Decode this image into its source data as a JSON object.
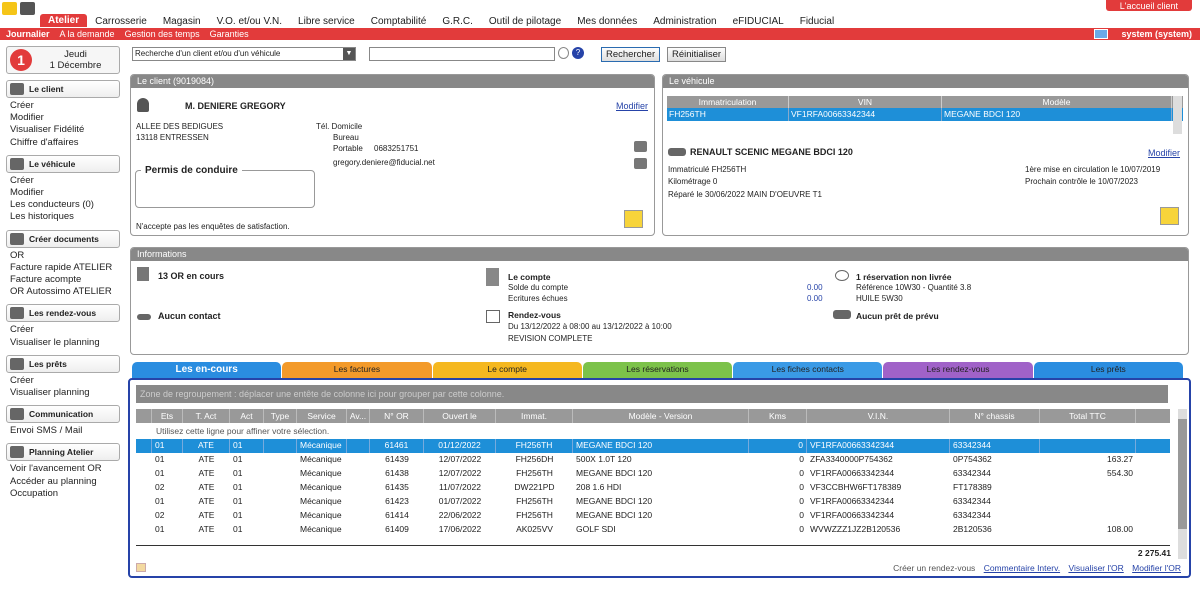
{
  "topnav": {
    "accueil": "L'accueil client",
    "menu": [
      "Atelier",
      "Carrosserie",
      "Magasin",
      "V.O. et/ou V.N.",
      "Libre service",
      "Comptabilité",
      "G.R.C.",
      "Outil de pilotage",
      "Mes données",
      "Administration",
      "eFIDUCIAL",
      "Fiducial"
    ]
  },
  "subnav": {
    "items": [
      "Journalier",
      "A la demande",
      "Gestion des temps",
      "Garanties"
    ],
    "user": "system (system)"
  },
  "sidebar": {
    "date_badge": "1",
    "date_day": "Jeudi",
    "date_full": "1 Décembre",
    "sections": [
      {
        "title": "Le client",
        "icon": "person-icon",
        "links": [
          "Créer",
          "Modifier",
          "Visualiser Fidélité",
          "Chiffre d'affaires"
        ]
      },
      {
        "title": "Le véhicule",
        "icon": "car-icon",
        "links": [
          "Créer",
          "Modifier",
          "Les conducteurs (0)",
          "Les historiques"
        ]
      },
      {
        "title": "Créer documents",
        "icon": "document-icon",
        "links": [
          "OR",
          "Facture rapide ATELIER",
          "Facture acompte",
          "OR Autossimo ATELIER"
        ]
      },
      {
        "title": "Les rendez-vous",
        "icon": "calendar-icon",
        "links": [
          "Créer",
          "Visualiser le planning"
        ]
      },
      {
        "title": "Les prêts",
        "icon": "person-icon",
        "links": [
          "Créer",
          "Visualiser planning"
        ]
      },
      {
        "title": "Communication",
        "icon": "phone-icon",
        "links": [
          "Envoi SMS / Mail"
        ]
      },
      {
        "title": "Planning Atelier",
        "icon": "calendar-icon",
        "links": [
          "Voir l'avancement OR",
          "Accéder au planning",
          "Occupation"
        ]
      }
    ]
  },
  "search": {
    "select_value": "Recherche d'un client et/ou d'un véhicule",
    "search_label": "Rechercher",
    "reset_label": "Réinitialiser"
  },
  "client": {
    "header": "Le client (9019084)",
    "name": "M. DENIERE GREGORY",
    "modify": "Modifier",
    "address1": "ALLEE DES BEDIGUES",
    "address2": "13118 ENTRESSEN",
    "tel_label": "Tél. Domicile",
    "bureau": "Bureau",
    "portable_label": "Portable",
    "portable": "0683251751",
    "email": "gregory.deniere@fiducial.net",
    "permis": "Permis de conduire",
    "enquete": "N'accepte pas les enquêtes de satisfaction."
  },
  "vehicle": {
    "header": "Le véhicule",
    "columns": [
      "Immatriculation",
      "VIN",
      "Modèle"
    ],
    "row": [
      "FH256TH",
      "VF1RFA00663342344",
      "MEGANE BDCI 120"
    ],
    "title": "RENAULT SCENIC MEGANE BDCI 120",
    "modify": "Modifier",
    "immat": "Immatriculé FH256TH",
    "km": "Kilométrage 0",
    "repare": "Réparé le 30/06/2022 MAIN D'OEUVRE T1",
    "mise_circ": "1ère mise en circulation le 10/07/2019",
    "controle": "Prochain contrôle le 10/07/2023"
  },
  "info": {
    "header": "Informations",
    "or_en_cours": "13 OR en cours",
    "contact": "Aucun contact",
    "compte_title": "Le compte",
    "solde_label": "Solde du compte",
    "solde": "0.00",
    "echues_label": "Ecritures échues",
    "echues": "0.00",
    "rdv_title": "Rendez-vous",
    "rdv_dates": "Du 13/12/2022 à 08:00 au 13/12/2022 à 10:00",
    "rdv_desc": "REVISION COMPLETE",
    "reservation": "1 réservation non livrée",
    "ref": "Référence 10W30 - Quantité 3.8",
    "huile": "HUILE 5W30",
    "pret": "Aucun prêt de prévu"
  },
  "tabs": [
    {
      "label": "Les en-cours",
      "color": "#2a8de0"
    },
    {
      "label": "Les factures",
      "color": "#f39a2a"
    },
    {
      "label": "Le compte",
      "color": "#f5b820"
    },
    {
      "label": "Les réservations",
      "color": "#7cc24a"
    },
    {
      "label": "Les fiches contacts",
      "color": "#3a9ae6"
    },
    {
      "label": "Les rendez-vous",
      "color": "#a062c8"
    },
    {
      "label": "Les prêts",
      "color": "#2a8de0"
    }
  ],
  "grid": {
    "group_hint": "Zone de regroupement : déplacer une entête de colonne ici pour grouper par cette colonne.",
    "filter_hint": "Utilisez cette ligne pour affiner votre sélection.",
    "columns": [
      "Ets",
      "T. Act",
      "Act",
      "Type",
      "Service",
      "Av...",
      "N° OR",
      "Ouvert le",
      "Immat.",
      "Modèle - Version",
      "Kms",
      "V.I.N.",
      "N° chassis",
      "Total TTC"
    ],
    "rows": [
      [
        "01",
        "ATE",
        "01",
        "",
        "Mécanique",
        "",
        "61461",
        "01/12/2022",
        "FH256TH",
        "MEGANE BDCI 120",
        "0",
        "VF1RFA00663342344",
        "63342344",
        ""
      ],
      [
        "01",
        "ATE",
        "01",
        "",
        "Mécanique",
        "",
        "61439",
        "12/07/2022",
        "FH256DH",
        "500X 1.0T 120",
        "0",
        "ZFA3340000P754362",
        "0P754362",
        "163.27"
      ],
      [
        "01",
        "ATE",
        "01",
        "",
        "Mécanique",
        "",
        "61438",
        "12/07/2022",
        "FH256TH",
        "MEGANE BDCI 120",
        "0",
        "VF1RFA00663342344",
        "63342344",
        "554.30"
      ],
      [
        "02",
        "ATE",
        "01",
        "",
        "Mécanique",
        "",
        "61435",
        "11/07/2022",
        "DW221PD",
        "208 1.6 HDI",
        "0",
        "VF3CCBHW6FT178389",
        "FT178389",
        ""
      ],
      [
        "01",
        "ATE",
        "01",
        "",
        "Mécanique",
        "",
        "61423",
        "01/07/2022",
        "FH256TH",
        "MEGANE BDCI 120",
        "0",
        "VF1RFA00663342344",
        "63342344",
        ""
      ],
      [
        "02",
        "ATE",
        "01",
        "",
        "Mécanique",
        "",
        "61414",
        "22/06/2022",
        "FH256TH",
        "MEGANE BDCI 120",
        "0",
        "VF1RFA00663342344",
        "63342344",
        ""
      ],
      [
        "01",
        "ATE",
        "01",
        "",
        "Mécanique",
        "",
        "61409",
        "17/06/2022",
        "AK025VV",
        "GOLF SDI",
        "0",
        "WVWZZZ1JZ2B120536",
        "2B120536",
        "108.00"
      ]
    ],
    "total": "2 275.41",
    "footer_links": [
      "Créer un rendez-vous",
      "Commentaire Interv.",
      "Visualiser l'OR",
      "Modifier l'OR"
    ]
  }
}
